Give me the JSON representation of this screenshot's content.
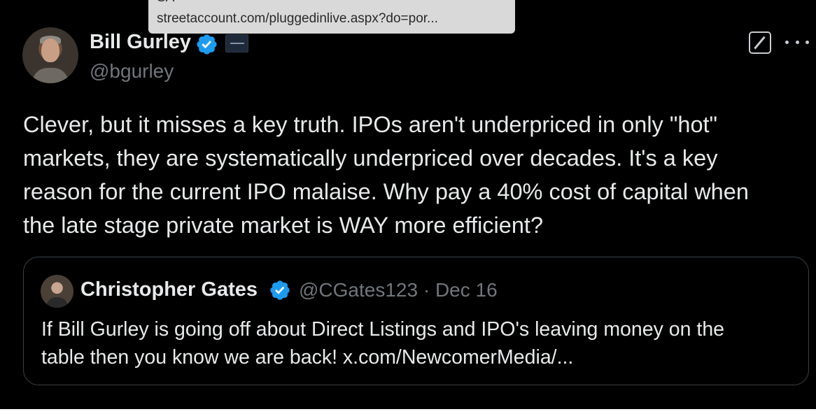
{
  "tooltip": {
    "line1": "SA",
    "line2": "streetaccount.com/pluggedinlive.aspx?do=por..."
  },
  "author": {
    "name": "Bill Gurley",
    "handle": "@bgurley",
    "verified": true
  },
  "tweet": {
    "lines": [
      "Clever, but it misses a key truth. IPOs aren't underpriced in only \"hot\"",
      "markets, they are systematically underpriced over decades. It's a key",
      "reason for the current IPO malaise. Why pay a 40% cost of capital when",
      "the late stage private market is WAY more efficient?"
    ]
  },
  "quote": {
    "name": "Christopher Gates",
    "meta": "@CGates123 · Dec 16",
    "verified": true,
    "lines": [
      "If Bill Gurley is going off about Direct Listings and IPO's leaving money on the",
      "table then you know we are back! x.com/NewcomerMedia/..."
    ]
  },
  "icons": {
    "grok": "grok-icon",
    "more": "more-icon",
    "verified": "verified-badge-icon"
  },
  "colors": {
    "background": "#000000",
    "text": "#e7e9ea",
    "muted": "#71767b",
    "verified_blue": "#1d9bf0",
    "tooltip_bg": "#d9d9d9"
  }
}
